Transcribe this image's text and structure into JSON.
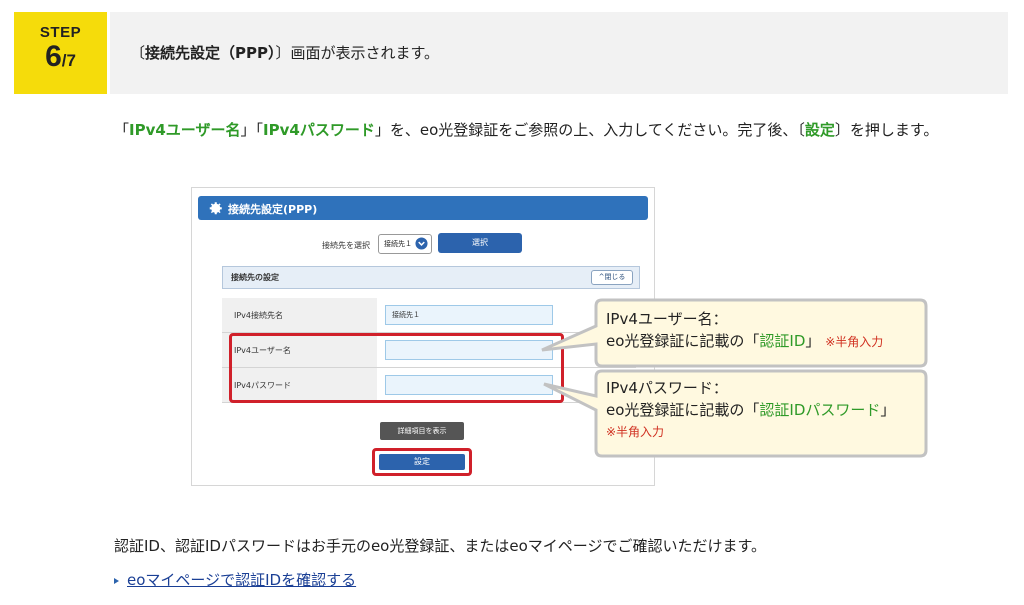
{
  "step": {
    "label": "STEP",
    "current": "6",
    "total": "/7",
    "title_pre": "〔",
    "title_bold": "接続先設定（PPP）",
    "title_post": "〕画面が表示されます。"
  },
  "instruction": {
    "q1_open": "「",
    "field1": "IPv4ユーザー名",
    "q1_close": "」",
    "q2_open": "「",
    "field2": "IPv4パスワード",
    "q2_close": "」",
    "mid": "を、eo光登録証をご参照の上、入力してください。完了後、〔",
    "button": "設定",
    "end": "〕を押します。"
  },
  "figure": {
    "title": "接続先設定(PPP)",
    "select_label": "接続先を選択",
    "select_value": "接続先１",
    "select_button": "選択",
    "section_title": "接続先の設定",
    "close_button": "閉じる",
    "rows": [
      {
        "label": "IPv4接続先名",
        "value": "接続先１"
      },
      {
        "label": "IPv4ユーザー名",
        "value": ""
      },
      {
        "label": "IPv4パスワード",
        "value": ""
      }
    ],
    "detail_button": "詳細項目を表示",
    "submit_button": "設定"
  },
  "callouts": {
    "c1_line1": "IPv4ユーザー名：",
    "c1_line2_pre": "eo光登録証に記載の「",
    "c1_line2_highlight": "認証ID",
    "c1_line2_post": "」",
    "c1_note": "※半角入力",
    "c2_line1": "IPv4パスワード：",
    "c2_line2_pre": "eo光登録証に記載の「",
    "c2_line2_highlight": "認証IDパスワード",
    "c2_line2_post": "」",
    "c2_note": "※半角入力"
  },
  "note": "認証ID、認証IDパスワードはお手元のeo光登録証、またはeoマイページでご確認いただけます。",
  "link": "eoマイページで認証IDを確認する",
  "colors": {
    "badge": "#f5dc0b",
    "green": "#2f9a28",
    "red": "#d0202a",
    "blue": "#2f72bb"
  }
}
